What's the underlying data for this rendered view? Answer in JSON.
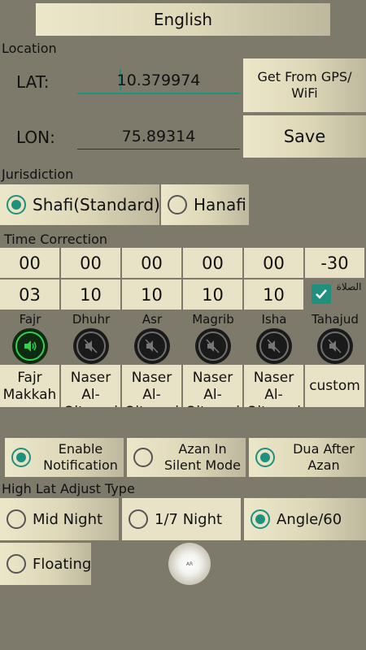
{
  "language": {
    "label": "English"
  },
  "location": {
    "section_label": "Location",
    "lat_label": "LAT:",
    "lat_value": "10.379974",
    "lon_label": "LON:",
    "lon_value": "75.89314",
    "gps_button": "Get From GPS/ WiFi",
    "save_button": "Save"
  },
  "jurisdiction": {
    "section_label": "Jurisdiction",
    "options": [
      {
        "label": "Shafi(Standard)",
        "selected": true
      },
      {
        "label": "Hanafi",
        "selected": false
      }
    ]
  },
  "time_correction": {
    "section_label": "Time Correction",
    "row1": [
      "00",
      "00",
      "00",
      "00",
      "00",
      "-30"
    ],
    "row2": [
      "03",
      "10",
      "10",
      "10",
      "10"
    ],
    "checkbox_label": "الصلاة",
    "checkbox_checked": true
  },
  "prayers": [
    {
      "name": "Fajr",
      "sound_on": true,
      "method": "Fajr Makkah"
    },
    {
      "name": "Dhuhr",
      "sound_on": false,
      "method": "Naser Al-Qitaami"
    },
    {
      "name": "Asr",
      "sound_on": false,
      "method": "Naser Al-Qitaami"
    },
    {
      "name": "Magrib",
      "sound_on": false,
      "method": "Naser Al-Qitaami"
    },
    {
      "name": "Isha",
      "sound_on": false,
      "method": "Naser Al-Qitaami"
    },
    {
      "name": "Tahajud",
      "sound_on": false,
      "method": "custom"
    }
  ],
  "notifications": [
    {
      "label": "Enable Notification",
      "selected": true
    },
    {
      "label": "Azan In Silent Mode",
      "selected": false
    },
    {
      "label": "Dua After Azan",
      "selected": true
    }
  ],
  "high_lat": {
    "section_label": "High Lat Adjust Type",
    "options": [
      {
        "label": "Mid Night",
        "selected": false
      },
      {
        "label": "1/7 Night",
        "selected": false
      },
      {
        "label": "Angle/60",
        "selected": true
      },
      {
        "label": "Floating",
        "selected": false
      }
    ]
  },
  "floating_badge": "AR",
  "colors": {
    "accent": "#1f8f7e",
    "background": "#7d7a6b",
    "tile": "#e8e3c6",
    "sound_on": "#2fd34c"
  }
}
